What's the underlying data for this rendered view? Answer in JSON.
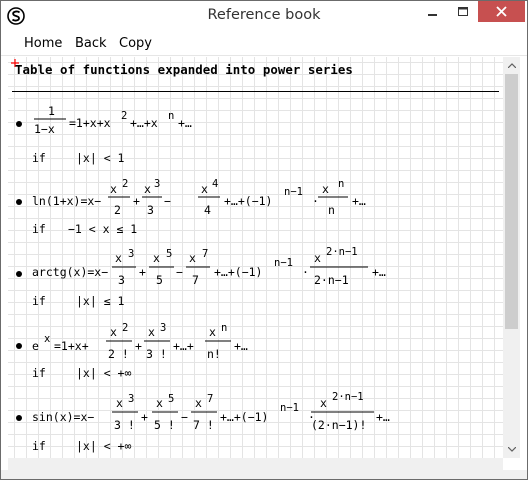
{
  "window": {
    "title": "Reference book",
    "icon": "app-logo-icon",
    "controls": [
      "minimize-icon",
      "maximize-icon",
      "close-icon"
    ],
    "close_color": "#c75050"
  },
  "menu": {
    "items": [
      "Home",
      "Back",
      "Copy"
    ]
  },
  "document": {
    "heading": "Table of functions expanded into power series",
    "entries": [
      {
        "name": "1/(1-x)",
        "formula": "1/(1−x) = 1 + x + x^2 + … + x^n + …",
        "condition_label": "if",
        "condition": "|x| < 1"
      },
      {
        "name": "ln(1+x)",
        "formula": "ln(1+x) = x − x^2/2 + x^3/3 − x^4/4 + … + (−1)^(n−1) · x^n/n + …",
        "condition_label": "if",
        "condition": "−1 < x ≤ 1"
      },
      {
        "name": "arctg(x)",
        "formula": "arctg(x) = x − x^3/3 + x^5/5 − x^7/7 + … + (−1)^(n−1) · x^(2·n−1)/(2·n−1) + …",
        "condition_label": "if",
        "condition": "|x| ≤ 1"
      },
      {
        "name": "e^x",
        "formula": "e^x = 1 + x + x^2/2! + x^3/3! + … + x^n/n! + …",
        "condition_label": "if",
        "condition": "|x| < +∞"
      },
      {
        "name": "sin(x)",
        "formula": "sin(x) = x − x^3/3! + x^5/5! − x^7/7! + … + (−1)^(n−1) · x^(2·n−1)/(2·n−1)! + …",
        "condition_label": "if",
        "condition": "|x| < +∞"
      }
    ]
  },
  "colors": {
    "grid": "#e4e4e4",
    "cursor_mark": "#ff0000",
    "scrollbar_thumb": "#cdcdcd"
  }
}
